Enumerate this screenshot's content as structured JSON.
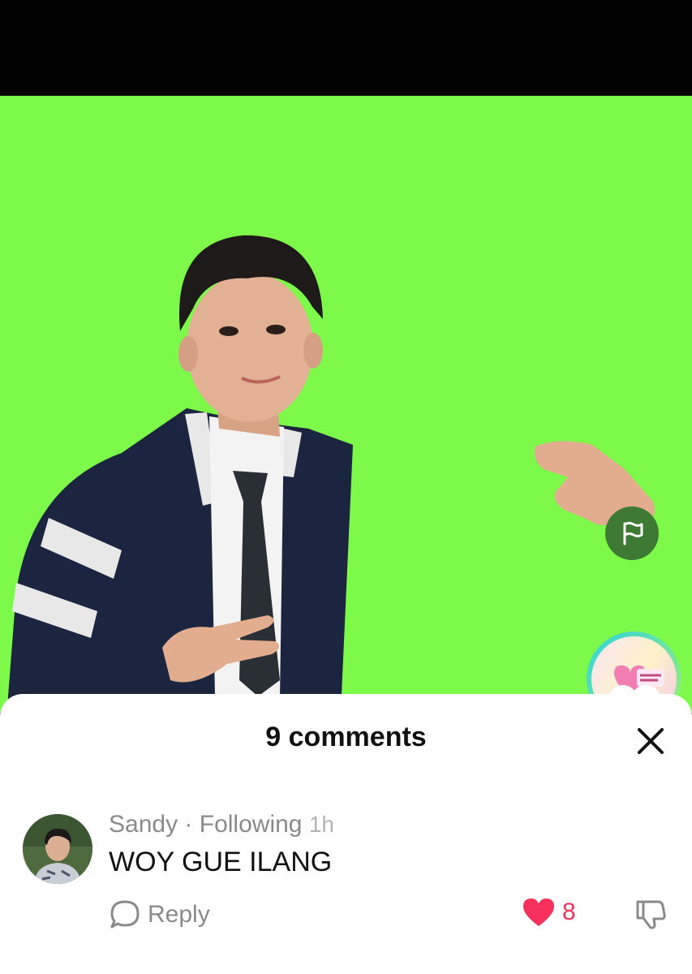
{
  "video": {
    "background": "#7df94a",
    "icons": {
      "report": "flag-icon",
      "follow": "plus-icon",
      "creator": "creator-avatar"
    }
  },
  "comments_sheet": {
    "title": "9 comments",
    "close_icon": "close-icon",
    "comments": [
      {
        "author": "Sandy",
        "separator": " · ",
        "relation": "Following",
        "time": "1h",
        "text": "WOY GUE ILANG",
        "reply_label": "Reply",
        "likes": "8"
      }
    ]
  },
  "colors": {
    "accent": "#f5315c",
    "green_screen": "#7df94a",
    "muted": "#8a8a8a"
  }
}
